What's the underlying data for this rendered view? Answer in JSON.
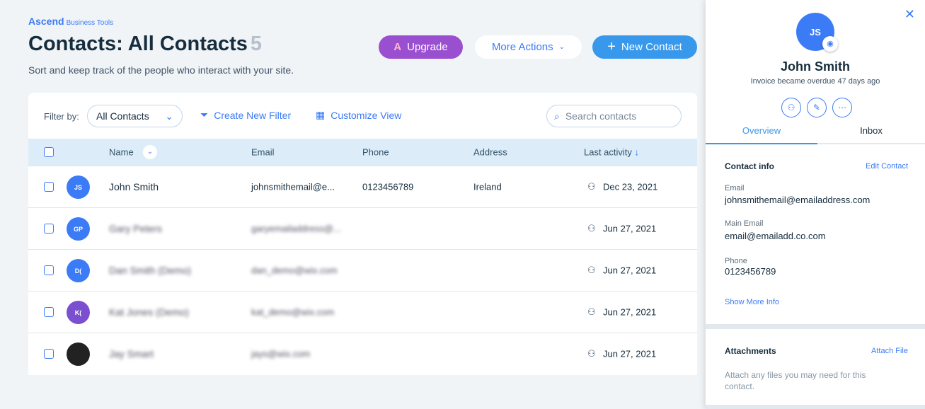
{
  "brand": {
    "name": "Ascend",
    "tagline": "Business Tools"
  },
  "header": {
    "title": "Contacts: All Contacts",
    "count": "5",
    "subtitle": "Sort and keep track of the people who interact with your site."
  },
  "actions": {
    "upgrade": "Upgrade",
    "more": "More Actions",
    "new_contact": "New Contact"
  },
  "toolbar": {
    "filter_label": "Filter by:",
    "filter_value": "All Contacts",
    "create_filter": "Create New Filter",
    "customize": "Customize View",
    "search_placeholder": "Search contacts"
  },
  "columns": {
    "name": "Name",
    "email": "Email",
    "phone": "Phone",
    "address": "Address",
    "last_activity": "Last activity"
  },
  "rows": [
    {
      "initials": "JS",
      "name": "John Smith",
      "email": "johnsmithemail@e...",
      "phone": "0123456789",
      "address": "Ireland",
      "date": "Dec 23, 2021",
      "color": "#3b7bf6",
      "blurred": false
    },
    {
      "initials": "GP",
      "name": "Gary Peters",
      "email": "garyemailaddress@...",
      "phone": "",
      "address": "",
      "date": "Jun 27, 2021",
      "color": "#3b7bf6",
      "blurred": true
    },
    {
      "initials": "D(",
      "name": "Dan Smith (Demo)",
      "email": "dan_demo@wix.com",
      "phone": "",
      "address": "",
      "date": "Jun 27, 2021",
      "color": "#3b7bf6",
      "blurred": true
    },
    {
      "initials": "K(",
      "name": "Kat Jones (Demo)",
      "email": "kat_demo@wix.com",
      "phone": "",
      "address": "",
      "date": "Jun 27, 2021",
      "color": "#7a4fd0",
      "blurred": true
    },
    {
      "initials": "",
      "name": "Jay Smart",
      "email": "jays@wix.com",
      "phone": "",
      "address": "",
      "date": "Jun 27, 2021",
      "color": "#222222",
      "blurred": true
    }
  ],
  "panel": {
    "initials": "JS",
    "name": "John Smith",
    "status": "Invoice became overdue 47 days ago",
    "tabs": [
      "Overview",
      "Inbox"
    ],
    "contact_info": {
      "title": "Contact info",
      "edit": "Edit Contact",
      "email_label": "Email",
      "email": "johnsmithemail@emailaddress.com",
      "main_email_label": "Main Email",
      "main_email": "email@emailadd.co.com",
      "phone_label": "Phone",
      "phone": "0123456789",
      "show_more": "Show More Info"
    },
    "attachments": {
      "title": "Attachments",
      "attach": "Attach File",
      "hint": "Attach any files you may need for this contact."
    }
  }
}
